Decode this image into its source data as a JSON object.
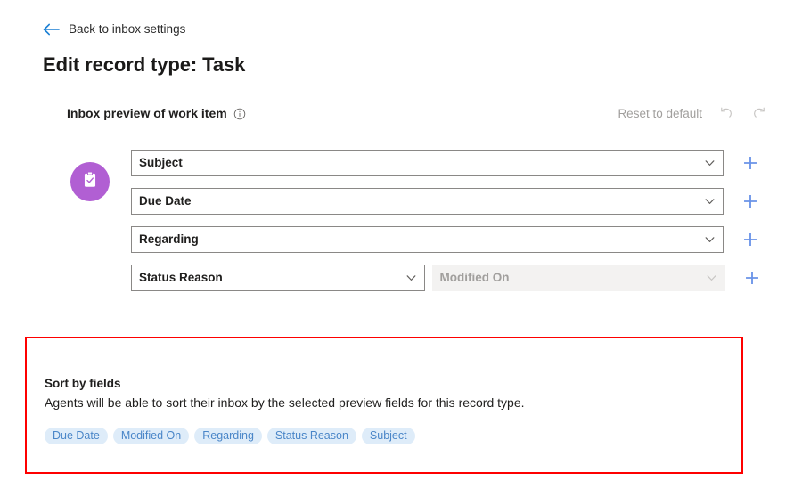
{
  "back": {
    "label": "Back to inbox settings",
    "icon": "arrow-left-icon",
    "color": "#0f6cbd"
  },
  "page_title": "Edit record type: Task",
  "section": {
    "title": "Inbox preview of work item",
    "info_icon": "info-icon",
    "reset_label": "Reset to default",
    "undo_icon": "undo-icon",
    "redo_icon": "redo-icon",
    "disabled_color": "#a19f9d"
  },
  "entity": {
    "icon": "task-clipboard-icon",
    "badge_color": "#b15fd3"
  },
  "preview_rows": [
    {
      "primary": {
        "value": "Subject",
        "placeholder": "Select a field",
        "disabled": false,
        "width": "full"
      },
      "secondary": null,
      "add_label": "+"
    },
    {
      "primary": {
        "value": "Due Date",
        "placeholder": "Select a field",
        "disabled": false,
        "width": "full"
      },
      "secondary": null,
      "add_label": "+"
    },
    {
      "primary": {
        "value": "Regarding",
        "placeholder": "Select a field",
        "disabled": false,
        "width": "full"
      },
      "secondary": null,
      "add_label": "+"
    },
    {
      "primary": {
        "value": "Status Reason",
        "placeholder": "Select a field",
        "disabled": false,
        "width": "half"
      },
      "secondary": {
        "value": "Modified On",
        "placeholder": "Modified On",
        "disabled": true,
        "width": "half"
      },
      "add_label": "+"
    }
  ],
  "sort_section": {
    "title": "Sort by fields",
    "description": "Agents will be able to sort their inbox by the selected preview fields for this record type.",
    "chips": [
      "Due Date",
      "Modified On",
      "Regarding",
      "Status Reason",
      "Subject"
    ],
    "highlight_color": "#fe0000",
    "chip_bg": "#deecf9",
    "chip_text": "#4a86c8"
  },
  "colors": {
    "accent_blue": "#0f6cbd",
    "add_blue": "#6a93e8",
    "border_grey": "#8a8886",
    "disabled_bg": "#f3f2f1"
  }
}
